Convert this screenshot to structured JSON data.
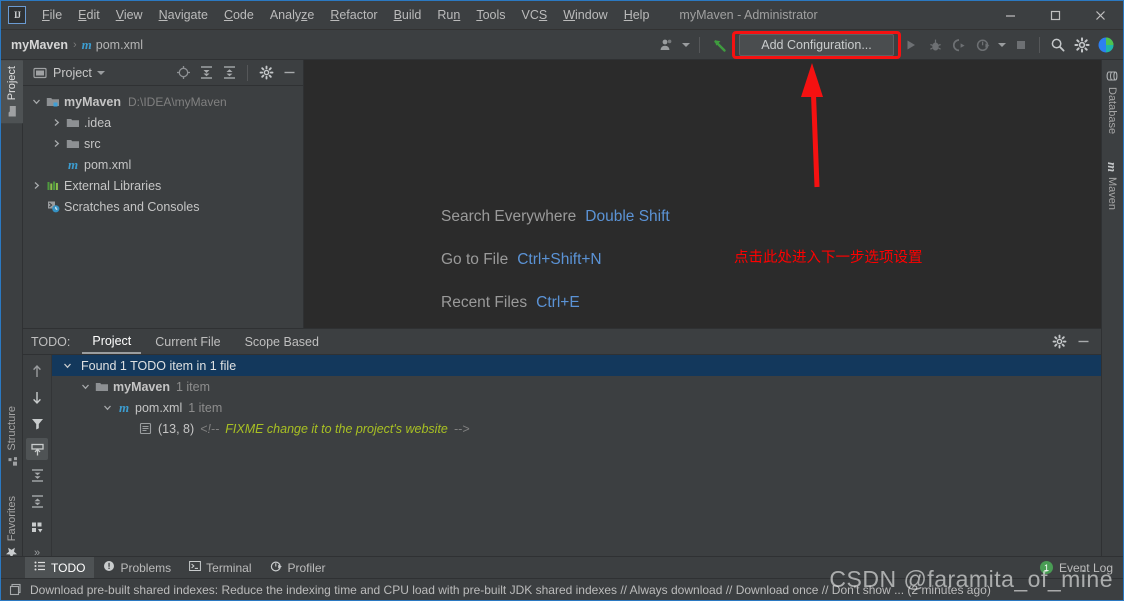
{
  "window": {
    "title": "myMaven - Administrator",
    "app_logo": "IJ",
    "controls": {
      "minimize": "minimize-icon",
      "maximize": "maximize-icon",
      "close": "close-icon"
    }
  },
  "menubar": {
    "items": [
      {
        "label": "File",
        "mnemonic": "F"
      },
      {
        "label": "Edit",
        "mnemonic": "E"
      },
      {
        "label": "View",
        "mnemonic": "V"
      },
      {
        "label": "Navigate",
        "mnemonic": "N"
      },
      {
        "label": "Code",
        "mnemonic": "C"
      },
      {
        "label": "Analyze",
        "mnemonic": "z"
      },
      {
        "label": "Refactor",
        "mnemonic": "R"
      },
      {
        "label": "Build",
        "mnemonic": "B"
      },
      {
        "label": "Run",
        "mnemonic": "n"
      },
      {
        "label": "Tools",
        "mnemonic": "T"
      },
      {
        "label": "VCS",
        "mnemonic": "S"
      },
      {
        "label": "Window",
        "mnemonic": "W"
      },
      {
        "label": "Help",
        "mnemonic": "H"
      }
    ]
  },
  "navbar": {
    "breadcrumb": {
      "project": "myMaven",
      "separator": "›",
      "file": "pom.xml",
      "file_icon": "m"
    }
  },
  "toolbar": {
    "buttons": [
      {
        "name": "user-avatar-dropdown",
        "icon": "person-icon"
      },
      {
        "name": "vcs-update-button",
        "icon": "green-arrow-icon"
      }
    ],
    "add_configuration_label": "Add Configuration...",
    "run_controls": [
      {
        "name": "run-button",
        "icon": "play-icon"
      },
      {
        "name": "debug-button",
        "icon": "bug-icon"
      },
      {
        "name": "run-with-coverage-button",
        "icon": "coverage-icon"
      },
      {
        "name": "profile-button",
        "icon": "profiler-icon"
      },
      {
        "name": "stop-button",
        "icon": "stop-square-icon"
      }
    ],
    "right_buttons": [
      {
        "name": "search-everywhere-button",
        "icon": "search-icon"
      },
      {
        "name": "settings-button",
        "icon": "gear-icon"
      },
      {
        "name": "ide-assistant-button",
        "icon": "colored-circle-icon"
      }
    ]
  },
  "left_tool_strip": [
    {
      "label": "Project",
      "icon": "project-folder-icon",
      "active": true
    },
    {
      "label": "Structure",
      "icon": "structure-icon",
      "active": false
    },
    {
      "label": "Favorites",
      "icon": "star-icon",
      "active": false
    }
  ],
  "right_tool_strip": [
    {
      "label": "Database",
      "icon": "database-icon"
    },
    {
      "label": "Maven",
      "icon": "maven-m-icon"
    }
  ],
  "project_panel": {
    "title": "Project",
    "tools": [
      {
        "name": "select-opened-file-button",
        "icon": "target-icon"
      },
      {
        "name": "expand-all-button",
        "icon": "expand-all-icon"
      },
      {
        "name": "collapse-all-button",
        "icon": "collapse-all-icon"
      },
      {
        "name": "panel-settings-button",
        "icon": "gear-icon"
      },
      {
        "name": "hide-panel-button",
        "icon": "minimize-icon"
      }
    ],
    "tree": [
      {
        "label": "myMaven",
        "path": "D:\\IDEA\\myMaven",
        "icon": "module-icon",
        "arrow": "⌄",
        "expanded": true,
        "indent": 0,
        "bold": true
      },
      {
        "label": ".idea",
        "path": "",
        "icon": "folder-icon",
        "arrow": "›",
        "expanded": false,
        "indent": 1,
        "bold": false
      },
      {
        "label": "src",
        "path": "",
        "icon": "folder-icon",
        "arrow": "›",
        "expanded": false,
        "indent": 1,
        "bold": false
      },
      {
        "label": "pom.xml",
        "path": "",
        "icon": "maven-m-icon",
        "arrow": "",
        "expanded": false,
        "indent": 1,
        "bold": false
      },
      {
        "label": "External Libraries",
        "path": "",
        "icon": "libraries-icon",
        "arrow": "›",
        "expanded": false,
        "indent": 0,
        "bold": false
      },
      {
        "label": "Scratches and Consoles",
        "path": "",
        "icon": "scratches-icon",
        "arrow": "",
        "expanded": false,
        "indent": 0,
        "bold": false
      }
    ]
  },
  "editor": {
    "tips": [
      {
        "label": "Search Everywhere",
        "shortcut": "Double Shift"
      },
      {
        "label": "Go to File",
        "shortcut": "Ctrl+Shift+N"
      },
      {
        "label": "Recent Files",
        "shortcut": "Ctrl+E"
      }
    ],
    "annotation": {
      "text": "点击此处进入下一步选项设置",
      "color": "#fe0000",
      "arrow": "red-up-arrow"
    }
  },
  "todo_panel": {
    "prefix_label": "TODO:",
    "tabs": [
      {
        "label": "Project",
        "active": true
      },
      {
        "label": "Current File",
        "active": false
      },
      {
        "label": "Scope Based",
        "active": false
      }
    ],
    "head_tools": [
      {
        "name": "todo-settings-button",
        "icon": "gear-icon"
      },
      {
        "name": "todo-hide-button",
        "icon": "minimize-icon"
      }
    ],
    "side_tools": [
      {
        "name": "previous-occurrence-button",
        "icon": "arrow-up-icon",
        "selected": false
      },
      {
        "name": "next-occurrence-button",
        "icon": "arrow-down-icon",
        "selected": false
      },
      {
        "name": "filter-button",
        "icon": "filter-icon",
        "selected": false
      },
      {
        "name": "autoscroll-to-source-button",
        "icon": "autoscroll-icon",
        "selected": true
      },
      {
        "name": "expand-all-button",
        "icon": "expand-all-icon",
        "selected": false
      },
      {
        "name": "collapse-all-button",
        "icon": "collapse-all-icon",
        "selected": false
      },
      {
        "name": "group-by-button",
        "icon": "group-by-icon",
        "selected": false
      },
      {
        "name": "more-options-button",
        "icon": "chevron-double-right-icon",
        "selected": false
      }
    ],
    "results_header": "Found 1 TODO item in 1 file",
    "nodes": [
      {
        "label": "myMaven",
        "count": "1 item",
        "icon": "folder-icon",
        "indent": 1,
        "bold": true
      },
      {
        "label": "pom.xml",
        "count": "1 item",
        "icon": "maven-m-icon",
        "indent": 2,
        "bold": true
      }
    ],
    "item": {
      "icon": "todo-line-icon",
      "position": "(13, 8)",
      "comment_open": "<!--",
      "text": "FIXME change it to the project's website",
      "comment_close": "-->",
      "todo_color": "#a8c023"
    }
  },
  "bottom_tabs": {
    "tabs": [
      {
        "label": "TODO",
        "icon": "todo-list-icon",
        "active": true
      },
      {
        "label": "Problems",
        "icon": "problems-icon",
        "active": false
      },
      {
        "label": "Terminal",
        "icon": "terminal-icon",
        "active": false
      },
      {
        "label": "Profiler",
        "icon": "profiler-icon",
        "active": false
      }
    ],
    "event_log": {
      "label": "Event Log",
      "badge": "1"
    }
  },
  "statusbar": {
    "icon": "notification-icon",
    "message": "Download pre-built shared indexes: Reduce the indexing time and CPU load with pre-built JDK shared indexes // Always download // Download once // Don't show ... (2 minutes ago)"
  },
  "watermark": {
    "text": "CSDN @faramita_of_mine"
  },
  "colors": {
    "background": "#3c3f41",
    "editor_background": "#2b2b2b",
    "accent_blue": "#2b79c2",
    "selection": "#13385c",
    "annotation_red": "#fe0000",
    "link_blue": "#5b93d6",
    "todo_green": "#a8c023",
    "maven_blue": "#3c9dd0"
  }
}
